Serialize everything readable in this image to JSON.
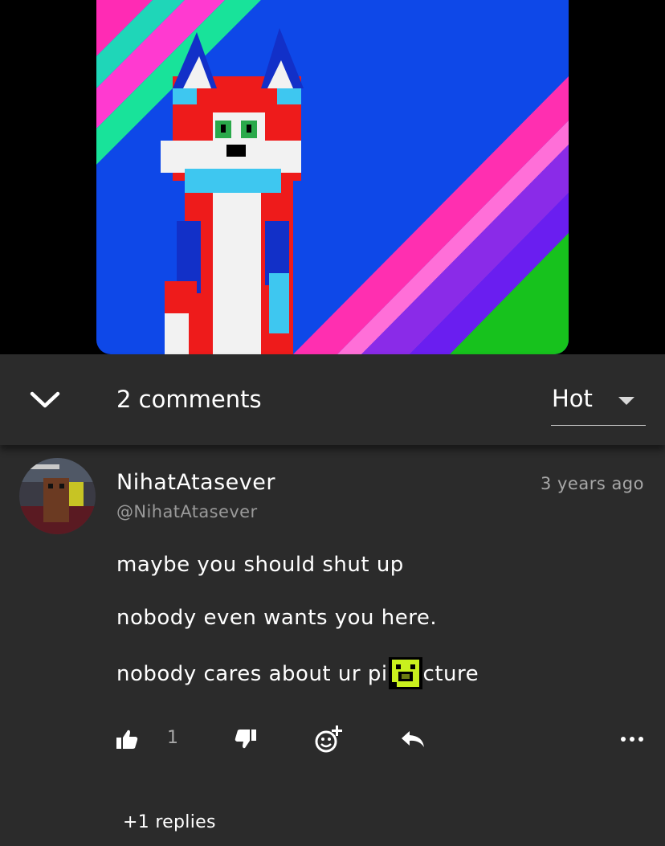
{
  "header": {
    "comment_count_label": "2 comments",
    "sort_selected": "Hot"
  },
  "comments": [
    {
      "author_name": "NihatAtasever",
      "author_handle": "@NihatAtasever",
      "timestamp": "3 years ago",
      "lines": [
        "maybe you should shut up",
        "nobody even wants you here.",
        "nobody cares about ur pi",
        "cture"
      ],
      "inline_emoji": "green-face-emoji",
      "like_count": "1",
      "replies_label": "+1 replies"
    }
  ],
  "icons": [
    "chevron-down-icon",
    "caret-down-icon",
    "thumbs-up-icon",
    "thumbs-down-icon",
    "add-reaction-icon",
    "reply-icon",
    "more-options-icon"
  ],
  "colors": {
    "background": "#2b2b2b",
    "text_primary": "#ffffff",
    "text_secondary": "#9a9a9a"
  }
}
